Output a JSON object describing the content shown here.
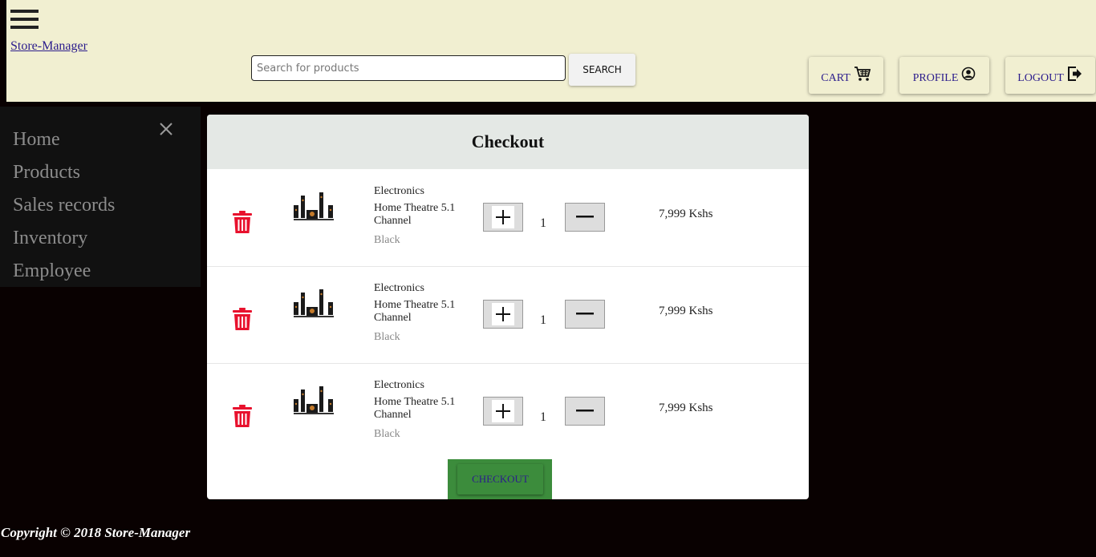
{
  "header": {
    "brand": "Store-Manager",
    "search_placeholder": "Search for products",
    "search_label": "SEARCH",
    "cart_label": "CART",
    "profile_label": "PROFILE",
    "logout_label": "LOGOUT"
  },
  "sidebar": {
    "items": [
      {
        "label": "Home"
      },
      {
        "label": "Products"
      },
      {
        "label": "Sales records"
      },
      {
        "label": "Inventory"
      },
      {
        "label": "Employee"
      }
    ]
  },
  "checkout": {
    "title": "Checkout",
    "items": [
      {
        "category": "Electronics",
        "name": "Home Theatre 5.1 Channel",
        "color": "Black",
        "quantity": "1",
        "price": "7,999 Kshs"
      },
      {
        "category": "Electronics",
        "name": "Home Theatre 5.1 Channel",
        "color": "Black",
        "quantity": "1",
        "price": "7,999 Kshs"
      },
      {
        "category": "Electronics",
        "name": "Home Theatre 5.1 Channel",
        "color": "Black",
        "quantity": "1",
        "price": "7,999 Kshs"
      }
    ],
    "button_label": "CHECKOUT"
  },
  "footer": {
    "text": "Copyright © 2018 Store-Manager"
  },
  "colors": {
    "page_bg": "#090101",
    "header_bg": "#f1efd1",
    "sidebar_bg": "#111111",
    "modal_header_bg": "#e4e8e5",
    "trash_red": "#e8112d",
    "checkout_green": "#3c8c3c",
    "link_purple": "#2b1c8c"
  }
}
